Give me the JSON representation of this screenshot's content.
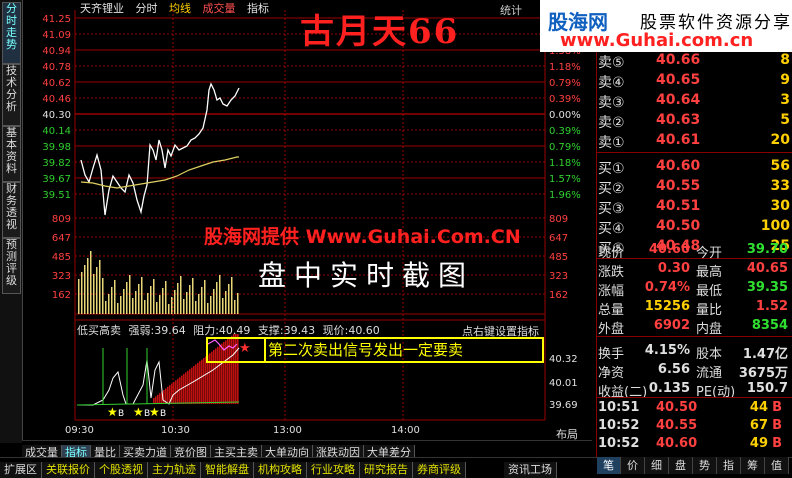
{
  "header": {
    "stock_name": "天齐锂业",
    "tab_time": "分时",
    "tab_avg": "均线",
    "tab_volume": "成交量",
    "tab_indicator": "指标",
    "stats": "统计"
  },
  "overlay": {
    "big_title": "古月天66",
    "watermark": "股海网提供 Www.Guhai.Com.CN",
    "screenshot_note": "盘中实时截图",
    "signal_text": "第二次卖出信号发出一定要卖"
  },
  "logo": {
    "name": "股海网",
    "slogan": "股票软件资源分享",
    "url": "www.Guhai.com.cn"
  },
  "left_tabs": [
    "分时走势",
    "技术分析",
    "基本资料",
    "财务透视",
    "预测评级"
  ],
  "price_axis": {
    "left": [
      "41.25",
      "41.09",
      "40.94",
      "40.78",
      "40.62",
      "40.46",
      "40.30",
      "40.14",
      "39.98",
      "39.82",
      "39.67",
      "39.51"
    ],
    "left_colors": [
      "red",
      "red",
      "red",
      "red",
      "red",
      "red",
      "white",
      "green",
      "green",
      "green",
      "green",
      "green"
    ],
    "right": [
      "2.38%",
      "1.98%",
      "1.58%",
      "1.18%",
      "0.79%",
      "0.39%",
      "0.00%",
      "0.39%",
      "0.79%",
      "1.18%",
      "1.57%",
      "1.96%"
    ],
    "right_colors": [
      "red",
      "red",
      "red",
      "red",
      "red",
      "red",
      "white",
      "green",
      "green",
      "green",
      "green",
      "green"
    ]
  },
  "volume_axis": {
    "left": [
      "809",
      "647",
      "485",
      "323",
      "162"
    ],
    "right": [
      "809",
      "647",
      "485",
      "323",
      "162"
    ]
  },
  "indicator": {
    "name": "低买高卖",
    "strength": "强弱:39.64",
    "resistance": "阻力:40.49",
    "support": "支撑:39.43",
    "current": "现价:40.60",
    "settings": "点右键设置指标",
    "axis_right": [
      "40.32",
      "40.01",
      "39.69"
    ],
    "marker_b": "B"
  },
  "time_axis": [
    "09:30",
    "10:30",
    "13:00",
    "14:00"
  ],
  "zoom_label": "布局",
  "bottom_tabs_row1": [
    "成交量",
    "指标",
    "量比",
    "买卖力道",
    "竞价图",
    "主买主卖",
    "大单动向",
    "涨跌动因",
    "大单差分"
  ],
  "bottom_tabs_row2": [
    "扩展区",
    "关联报价",
    "个股透视",
    "主力轨迹",
    "智能解盘",
    "机构攻略",
    "行业攻略",
    "研究报告",
    "券商评级"
  ],
  "bottom_right_label": "资讯工场",
  "order_book": {
    "sell": [
      {
        "label": "卖⑤",
        "price": "40.66",
        "vol": "8"
      },
      {
        "label": "卖④",
        "price": "40.65",
        "vol": "9"
      },
      {
        "label": "卖③",
        "price": "40.64",
        "vol": "3"
      },
      {
        "label": "卖②",
        "price": "40.63",
        "vol": "5"
      },
      {
        "label": "卖①",
        "price": "40.61",
        "vol": "20"
      }
    ],
    "buy": [
      {
        "label": "买①",
        "price": "40.60",
        "vol": "56"
      },
      {
        "label": "买②",
        "price": "40.55",
        "vol": "33"
      },
      {
        "label": "买③",
        "price": "40.51",
        "vol": "30"
      },
      {
        "label": "买④",
        "price": "40.50",
        "vol": "100"
      },
      {
        "label": "买⑤",
        "price": "40.48",
        "vol": "25"
      }
    ]
  },
  "quote": {
    "rows": [
      {
        "a": "现价",
        "b": "40.60",
        "bc": "red",
        "c": "今开",
        "d": "39.70",
        "dc": "grn"
      },
      {
        "a": "涨跌",
        "b": "0.30",
        "bc": "red",
        "c": "最高",
        "d": "40.65",
        "dc": "red"
      },
      {
        "a": "涨幅",
        "b": "0.74%",
        "bc": "red",
        "c": "最低",
        "d": "39.35",
        "dc": "grn"
      },
      {
        "a": "总量",
        "b": "15256",
        "bc": "yel",
        "c": "量比",
        "d": "1.52",
        "dc": "red"
      },
      {
        "a": "外盘",
        "b": "6902",
        "bc": "red",
        "c": "内盘",
        "d": "8354",
        "dc": "grn"
      },
      {
        "a": "换手",
        "b": "4.15%",
        "bc": "wht",
        "c": "股本",
        "d": "1.47亿",
        "dc": "wht"
      },
      {
        "a": "净资",
        "b": "6.56",
        "bc": "wht",
        "c": "流通",
        "d": "3675万",
        "dc": "wht"
      },
      {
        "a": "收益(二)",
        "b": "0.135",
        "bc": "wht",
        "c": "PE(动)",
        "d": "150.7",
        "dc": "wht"
      }
    ]
  },
  "ticks": [
    {
      "time": "10:51",
      "price": "40.50",
      "vol": "44",
      "side": "B"
    },
    {
      "time": "10:52",
      "price": "40.55",
      "vol": "67",
      "side": "B"
    },
    {
      "time": "10:52",
      "price": "40.60",
      "vol": "49",
      "side": "B"
    }
  ],
  "right_bottom_tabs": [
    "笔",
    "价",
    "细",
    "盘",
    "势",
    "指",
    "筹",
    "值"
  ],
  "colors": {
    "up": "#ff4040",
    "down": "#30d030",
    "price_line": "#ffffff",
    "avg_line": "#e0d060",
    "grid": "#990000"
  }
}
